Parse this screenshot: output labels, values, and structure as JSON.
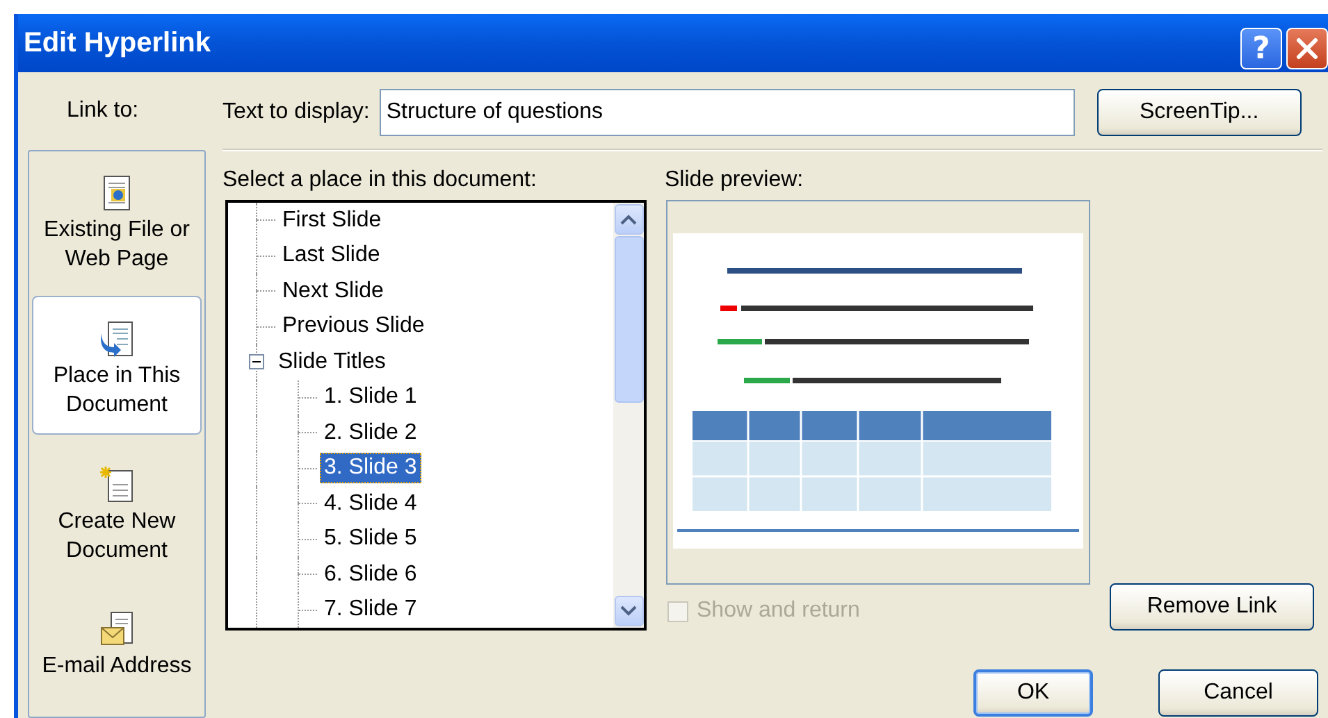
{
  "window": {
    "title": "Edit Hyperlink"
  },
  "title_buttons": [
    {
      "kind": "help",
      "label": "?"
    },
    {
      "kind": "close"
    }
  ],
  "link_to": {
    "label": "Link to:",
    "items": [
      {
        "label": "Existing File or Web Page",
        "kind": "file",
        "selected": false
      },
      {
        "label": "Place in This Document",
        "kind": "place",
        "selected": true
      },
      {
        "label": "Create New Document",
        "kind": "new",
        "selected": false
      },
      {
        "label": "E-mail Address",
        "kind": "email",
        "selected": false
      }
    ]
  },
  "text_to_display": {
    "label": "Text to display:",
    "value": "Structure of questions"
  },
  "screentip_button": "ScreenTip...",
  "place_list": {
    "label": "Select a place in this document:",
    "items": [
      {
        "label": "First Slide",
        "selected": false
      },
      {
        "label": "Last Slide",
        "selected": false
      },
      {
        "label": "Next Slide",
        "selected": false
      },
      {
        "label": "Previous Slide",
        "selected": false
      },
      {
        "label": "Slide Titles",
        "selected": false,
        "expanded": true,
        "children": [
          {
            "label": "1. Slide 1",
            "selected": false
          },
          {
            "label": "2. Slide 2",
            "selected": false
          },
          {
            "label": "3. Slide 3",
            "selected": true
          },
          {
            "label": "4. Slide 4",
            "selected": false
          },
          {
            "label": "5. Slide 5",
            "selected": false
          },
          {
            "label": "6. Slide 6",
            "selected": false
          },
          {
            "label": "7. Slide 7",
            "selected": false
          }
        ]
      }
    ]
  },
  "slide_preview": {
    "label": "Slide preview:",
    "kind": "picture"
  },
  "show_and_return": {
    "label": "Show and return",
    "checked": false,
    "disabled": true
  },
  "remove_link_button": "Remove Link",
  "buttons": [
    {
      "label": "OK",
      "default": true
    },
    {
      "label": "Cancel",
      "default": false
    }
  ]
}
